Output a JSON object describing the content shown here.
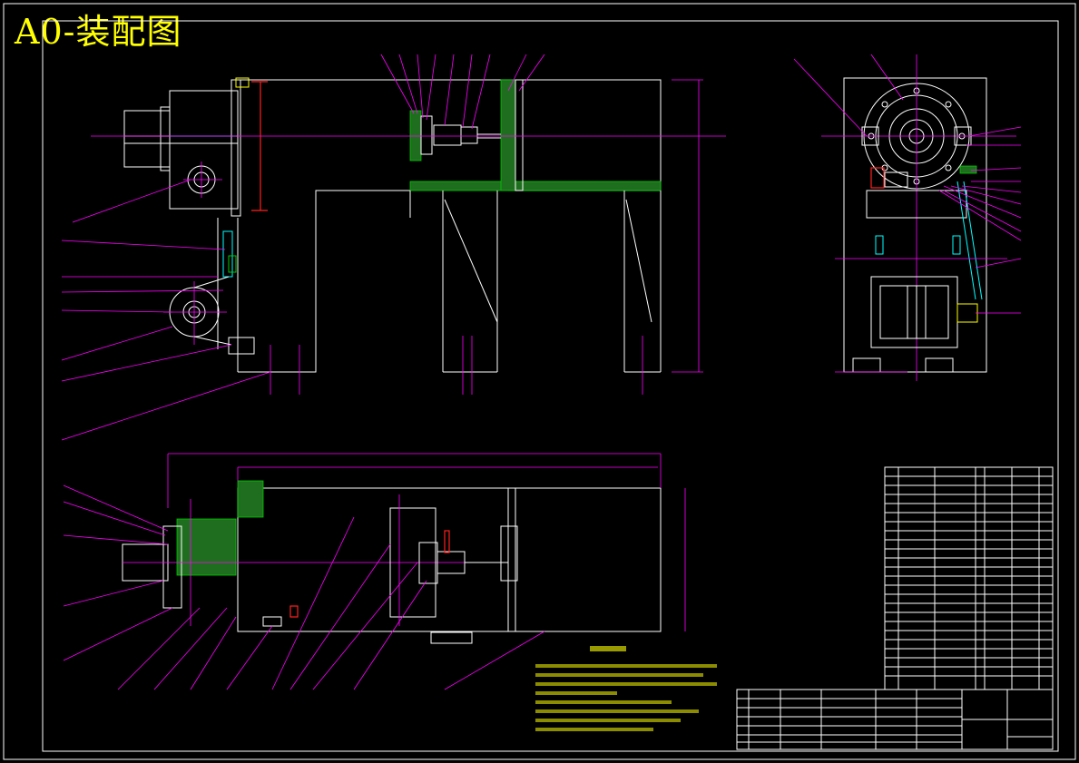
{
  "sheet": {
    "title": "A0-装配图"
  },
  "colors": {
    "background": "#000000",
    "frame": "#ffffff",
    "leader": "#ff00ff",
    "hatch": "#00cc00",
    "title": "#ffff00"
  }
}
